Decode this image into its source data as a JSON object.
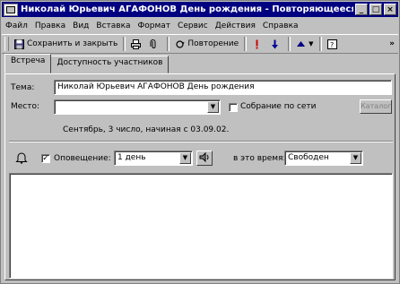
{
  "window": {
    "title": "Николай Юрьевич АГАФОНОВ День рождения - Повторяющееся собы...",
    "minimize": "_",
    "maximize": "□",
    "close": "×"
  },
  "menu": [
    "Файл",
    "Правка",
    "Вид",
    "Вставка",
    "Формат",
    "Сервис",
    "Действия",
    "Справка"
  ],
  "toolbar": {
    "save_close": "Сохранить и закрыть",
    "recurrence": "Повторение",
    "more": "»"
  },
  "tabs": [
    "Встреча",
    "Доступность участников"
  ],
  "form": {
    "subject_label": "Тема:",
    "subject_value": "Николай Юрьевич АГАФОНОВ День рождения",
    "location_label": "Место:",
    "location_value": "",
    "online_meeting_label": "Собрание по сети",
    "directory_button": "Каталог",
    "recurrence_info": "Сентябрь, 3 число, начиная с 03.09.02.",
    "reminder_checked": true,
    "reminder_label": "Оповещение:",
    "reminder_value": "1 день",
    "show_time_as_label": "в это время:",
    "show_time_as_value": "Свободен"
  },
  "colors": {
    "title_bar": "#000080",
    "importance_high": "#cc0000",
    "importance_low": "#000099"
  }
}
